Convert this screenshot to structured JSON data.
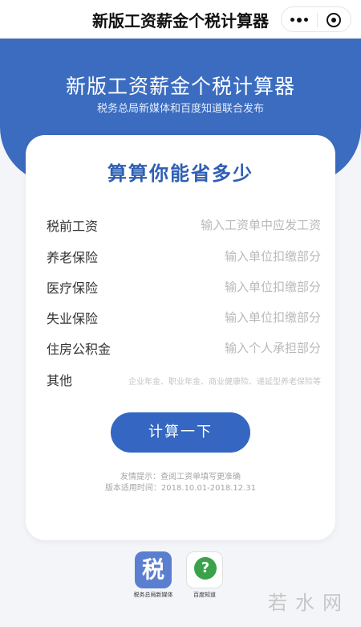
{
  "app": {
    "title": "新版工资薪金个税计算器"
  },
  "hero": {
    "title": "新版工资薪金个税计算器",
    "subtitle": "税务总局新媒体和百度知道联合发布"
  },
  "card": {
    "title": "算算你能省多少",
    "fields": [
      {
        "label": "税前工资",
        "placeholder": "输入工资单中应发工资"
      },
      {
        "label": "养老保险",
        "placeholder": "输入单位扣缴部分"
      },
      {
        "label": "医疗保险",
        "placeholder": "输入单位扣缴部分"
      },
      {
        "label": "失业保险",
        "placeholder": "输入单位扣缴部分"
      },
      {
        "label": "住房公积金",
        "placeholder": "输入个人承担部分"
      },
      {
        "label": "其他",
        "placeholder": "企业年金、职业年金、商业健康险、递延型养老保险等"
      }
    ],
    "calc_button": "计算一下",
    "tip_line1": "友情提示：查阅工资单填写更准确",
    "tip_line2": "版本适用时间：2018.10.01-2018.12.31"
  },
  "footer": {
    "logo1_char": "税",
    "logo1_label": "税务总局新媒体",
    "logo2_char": "?",
    "logo2_label": "百度知道",
    "watermark": "若水网"
  },
  "colors": {
    "primary": "#3b6cc0",
    "button": "#3567c2",
    "card_title": "#2f5fb3"
  }
}
